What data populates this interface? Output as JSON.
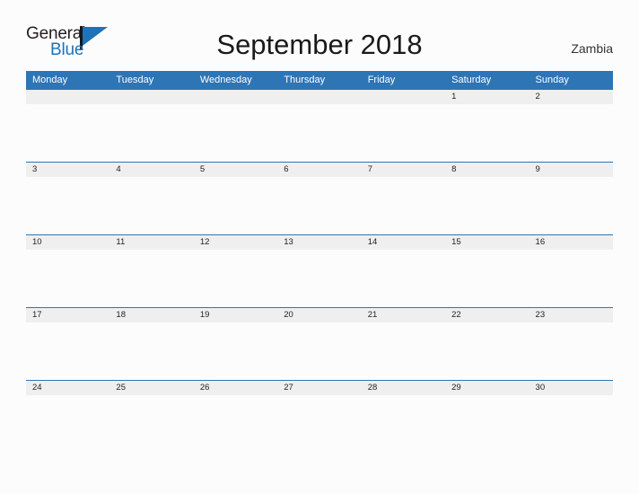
{
  "brand": {
    "name_part1": "General",
    "name_part2": "Blue",
    "logo_icon": "flag-triangle-icon"
  },
  "header": {
    "title": "September 2018",
    "country": "Zambia"
  },
  "colors": {
    "header_blue": "#2e75b6",
    "date_strip": "#efefef",
    "page_background": "#fcfcfc",
    "brand_blue": "#2072b8",
    "text": "#222222"
  },
  "calendar": {
    "month": "September",
    "year": "2018",
    "weekday_headers": [
      "Monday",
      "Tuesday",
      "Wednesday",
      "Thursday",
      "Friday",
      "Saturday",
      "Sunday"
    ],
    "weeks": [
      [
        "",
        "",
        "",
        "",
        "",
        "1",
        "2"
      ],
      [
        "3",
        "4",
        "5",
        "6",
        "7",
        "8",
        "9"
      ],
      [
        "10",
        "11",
        "12",
        "13",
        "14",
        "15",
        "16"
      ],
      [
        "17",
        "18",
        "19",
        "20",
        "21",
        "22",
        "23"
      ],
      [
        "24",
        "25",
        "26",
        "27",
        "28",
        "29",
        "30"
      ]
    ]
  }
}
